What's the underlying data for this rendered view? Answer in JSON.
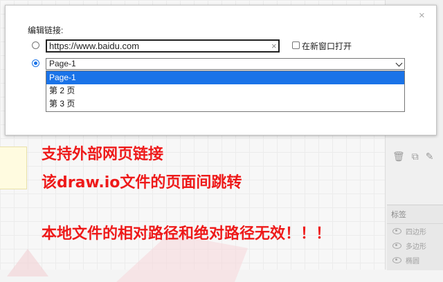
{
  "dialog": {
    "title": "编辑链接:",
    "url_value": "https://www.baidu.com",
    "clear_glyph": "×",
    "close_glyph": "×",
    "new_window_label": "在新窗口打开",
    "page_selected": "Page-1",
    "page_options": [
      "Page-1",
      "第 2 页",
      "第 3 页"
    ]
  },
  "annotations": {
    "line1": "支持外部网页链接",
    "line2": "该draw.io文件的页面间跳转",
    "line3": "本地文件的相对路径和绝对路径无效！！！",
    "color": "#ee1a1a"
  },
  "right_panel": {
    "tags_title": "标签",
    "layers": [
      "四边形",
      "多边形",
      "椭圆"
    ]
  },
  "colors": {
    "accent": "#1a73e8",
    "annotation": "#ee1a1a"
  }
}
